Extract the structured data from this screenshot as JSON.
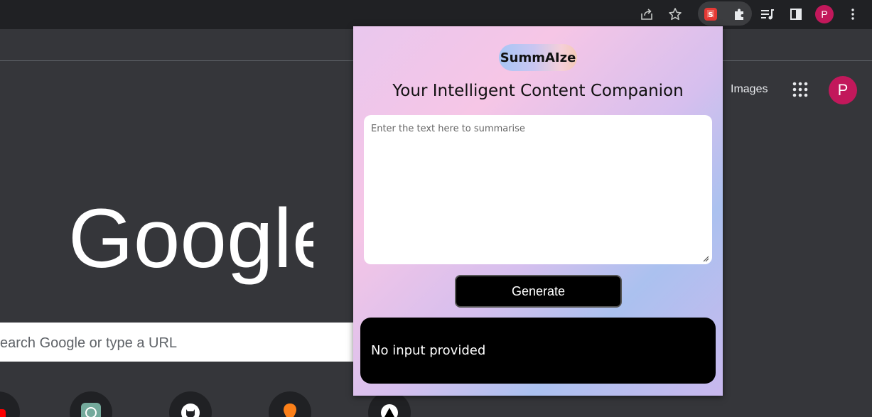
{
  "popup": {
    "brand": "SummAIze",
    "tagline": "Your Intelligent Content Companion",
    "input_placeholder": "Enter the text here to summarise",
    "input_value": "",
    "generate_label": "Generate",
    "output_text": "No input provided",
    "colors": {
      "gradient": [
        "#e9c7ee",
        "#f6c6e6",
        "#d6bfee",
        "#abc1ef",
        "#c9b8ee"
      ],
      "button": "#000000",
      "output_bg": "#000000"
    }
  },
  "browser": {
    "profile_initial": "P",
    "toolbar_icons": [
      "share-icon",
      "star-icon",
      "extension-summaize-icon",
      "puzzle-icon",
      "media-queue-icon",
      "side-panel-icon",
      "profile-icon",
      "kebab-menu-icon"
    ]
  },
  "ntp": {
    "images_link": "Images",
    "avatar_initial": "P",
    "search_placeholder": "earch Google or type a URL",
    "logo_text": "Google",
    "shortcuts": [
      "youtube-shortcut-icon",
      "chatgpt-shortcut-icon",
      "github-shortcut-icon",
      "swiggy-shortcut-icon",
      "vercel-shortcut-icon"
    ]
  }
}
